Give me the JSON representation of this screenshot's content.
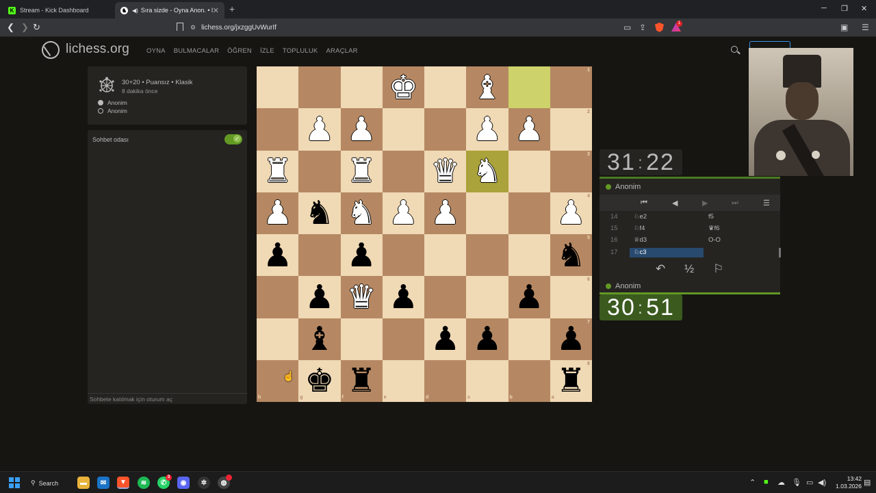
{
  "browser": {
    "tabs": [
      {
        "title": "Stream - Kick Dashboard",
        "icon": "K"
      },
      {
        "title": "Sıra sizde - Oyna Anon. • lich",
        "icon": "♞"
      }
    ],
    "new_tab": "+",
    "url": "lichess.org/jxzggUvWurIf"
  },
  "site": {
    "logo": "lichess.org",
    "nav": [
      "OYNA",
      "BULMACALAR",
      "ÖĞREN",
      "İZLE",
      "TOPLULUK",
      "ARAÇLAR"
    ]
  },
  "game_meta": {
    "setup": "30+20 • Puansız • Klasik",
    "time_ago": "8 dakika önce",
    "white": "Anonim",
    "black": "Anonim"
  },
  "chat": {
    "title": "Sohbet odası",
    "enabled": true,
    "login_hint": "Sohbete katılmak için oturum aç"
  },
  "board": {
    "orientation": "black",
    "highlight_squares": [
      "b1",
      "c3"
    ],
    "rank_labels": [
      "1",
      "2",
      "3",
      "4",
      "5",
      "6",
      "7",
      "8"
    ],
    "file_labels": [
      "h",
      "g",
      "f",
      "e",
      "d",
      "c",
      "b",
      "a"
    ],
    "pieces": [
      {
        "sq": "e1",
        "piece": "wK"
      },
      {
        "sq": "c1",
        "piece": "wB"
      },
      {
        "sq": "g2",
        "piece": "wP"
      },
      {
        "sq": "f2",
        "piece": "wP"
      },
      {
        "sq": "c2",
        "piece": "wP"
      },
      {
        "sq": "b2",
        "piece": "wP"
      },
      {
        "sq": "h3",
        "piece": "wR"
      },
      {
        "sq": "f3",
        "piece": "wR"
      },
      {
        "sq": "d3",
        "piece": "wQ"
      },
      {
        "sq": "c3",
        "piece": "wN"
      },
      {
        "sq": "h4",
        "piece": "wP"
      },
      {
        "sq": "g4",
        "piece": "bN"
      },
      {
        "sq": "f4",
        "piece": "wN"
      },
      {
        "sq": "e4",
        "piece": "wP"
      },
      {
        "sq": "d4",
        "piece": "wP"
      },
      {
        "sq": "a4",
        "piece": "wP"
      },
      {
        "sq": "h5",
        "piece": "bP"
      },
      {
        "sq": "f5",
        "piece": "bP"
      },
      {
        "sq": "a5",
        "piece": "bN"
      },
      {
        "sq": "g6",
        "piece": "bP"
      },
      {
        "sq": "f6",
        "piece": "wQ"
      },
      {
        "sq": "e6",
        "piece": "bP"
      },
      {
        "sq": "b6",
        "piece": "bP"
      },
      {
        "sq": "g7",
        "piece": "bB"
      },
      {
        "sq": "d7",
        "piece": "bP"
      },
      {
        "sq": "c7",
        "piece": "bP"
      },
      {
        "sq": "a7",
        "piece": "bP"
      },
      {
        "sq": "g8",
        "piece": "bK"
      },
      {
        "sq": "f8",
        "piece": "bR"
      },
      {
        "sq": "a8",
        "piece": "bR"
      }
    ]
  },
  "clocks": {
    "top": {
      "min": "31",
      "sec": "22"
    },
    "bottom": {
      "min": "30",
      "sec": "51"
    }
  },
  "players": {
    "top": "Anonim",
    "bottom": "Anonim"
  },
  "moves": [
    {
      "no": "14",
      "white": "♘e2",
      "black": "f5"
    },
    {
      "no": "15",
      "white": "♘f4",
      "black": "♛f6"
    },
    {
      "no": "16",
      "white": "♕d3",
      "black": "O-O"
    },
    {
      "no": "17",
      "white": "♘c3",
      "black": ""
    }
  ],
  "current_move": "17w",
  "actions": {
    "takeback": "↶",
    "draw": "½",
    "resign": "⚐"
  },
  "taskbar": {
    "search": "Search",
    "time": "13:42",
    "date": "1.03.2026"
  },
  "colors": {
    "light_square": "#f0d9b5",
    "dark_square": "#b58863",
    "highlight": "#cdd26a",
    "online": "#629924",
    "current_move": "#294a6f"
  }
}
